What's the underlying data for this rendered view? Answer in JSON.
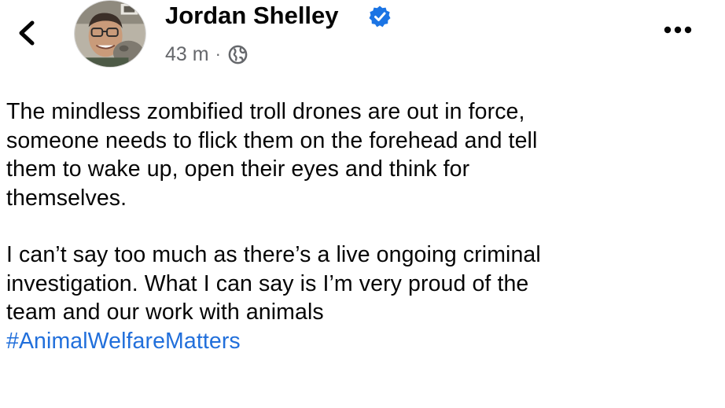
{
  "header": {
    "back_icon": "chevron-left-icon",
    "author_name": "Jordan Shelley",
    "verified_icon": "verified-badge-icon",
    "verified_color": "#1b74e4",
    "time_ago": "43 m",
    "separator": "·",
    "audience_icon": "globe-icon",
    "more_icon": "more-dots-icon"
  },
  "post": {
    "paragraph_1_lines": [
      "The mindless zombified troll drones are out in force,",
      "someone needs to flick them on the forehead and tell",
      "them to wake up, open their eyes and think for",
      "themselves."
    ],
    "paragraph_2_lines": [
      "I can’t say too much as there’s a live ongoing criminal",
      "investigation. What I can say is I’m very proud of the",
      "team and our work with animals"
    ],
    "hashtag": "#AnimalWelfareMatters",
    "hashtag_color": "#216fdb"
  }
}
